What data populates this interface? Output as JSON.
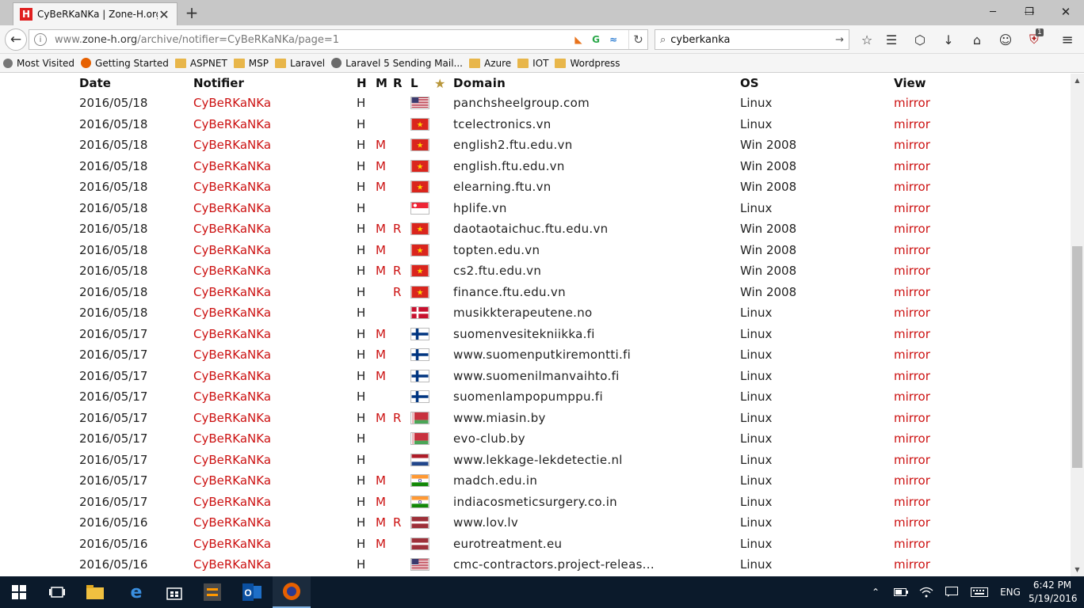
{
  "browser": {
    "tab_title": "CyBeRKaNKa | Zone-H.org",
    "tab_favicon": "H",
    "url_prefix": "www.",
    "url_host": "zone-h.org",
    "url_path": "/archive/notifier=CyBeRKaNKa/page=1",
    "search_query": "cyberkanka",
    "addon_badge": "1",
    "bookmarks": [
      "Most Visited",
      "Getting Started",
      "ASPNET",
      "MSP",
      "Laravel",
      "Laravel 5 Sending Mail...",
      "Azure",
      "IOT",
      "Wordpress"
    ]
  },
  "table": {
    "headers": {
      "date": "Date",
      "notifier": "Notifier",
      "h": "H",
      "m": "M",
      "r": "R",
      "l": "L",
      "domain": "Domain",
      "os": "OS",
      "view": "View"
    },
    "rows": [
      {
        "date": "2016/05/18",
        "notifier": "CyBeRKaNKa",
        "h": "H",
        "m": "",
        "r": "",
        "flag": "us",
        "domain": "panchsheelgroup.com",
        "os": "Linux",
        "view": "mirror"
      },
      {
        "date": "2016/05/18",
        "notifier": "CyBeRKaNKa",
        "h": "H",
        "m": "",
        "r": "",
        "flag": "vn",
        "domain": "tcelectronics.vn",
        "os": "Linux",
        "view": "mirror"
      },
      {
        "date": "2016/05/18",
        "notifier": "CyBeRKaNKa",
        "h": "H",
        "m": "M",
        "r": "",
        "flag": "vn",
        "domain": "english2.ftu.edu.vn",
        "os": "Win 2008",
        "view": "mirror"
      },
      {
        "date": "2016/05/18",
        "notifier": "CyBeRKaNKa",
        "h": "H",
        "m": "M",
        "r": "",
        "flag": "vn",
        "domain": "english.ftu.edu.vn",
        "os": "Win 2008",
        "view": "mirror"
      },
      {
        "date": "2016/05/18",
        "notifier": "CyBeRKaNKa",
        "h": "H",
        "m": "M",
        "r": "",
        "flag": "vn",
        "domain": "elearning.ftu.vn",
        "os": "Win 2008",
        "view": "mirror"
      },
      {
        "date": "2016/05/18",
        "notifier": "CyBeRKaNKa",
        "h": "H",
        "m": "",
        "r": "",
        "flag": "sg",
        "domain": "hplife.vn",
        "os": "Linux",
        "view": "mirror"
      },
      {
        "date": "2016/05/18",
        "notifier": "CyBeRKaNKa",
        "h": "H",
        "m": "M",
        "r": "R",
        "flag": "vn",
        "domain": "daotaotaichuc.ftu.edu.vn",
        "os": "Win 2008",
        "view": "mirror"
      },
      {
        "date": "2016/05/18",
        "notifier": "CyBeRKaNKa",
        "h": "H",
        "m": "M",
        "r": "",
        "flag": "vn",
        "domain": "topten.edu.vn",
        "os": "Win 2008",
        "view": "mirror"
      },
      {
        "date": "2016/05/18",
        "notifier": "CyBeRKaNKa",
        "h": "H",
        "m": "M",
        "r": "R",
        "flag": "vn",
        "domain": "cs2.ftu.edu.vn",
        "os": "Win 2008",
        "view": "mirror"
      },
      {
        "date": "2016/05/18",
        "notifier": "CyBeRKaNKa",
        "h": "H",
        "m": "",
        "r": "R",
        "flag": "vn",
        "domain": "finance.ftu.edu.vn",
        "os": "Win 2008",
        "view": "mirror"
      },
      {
        "date": "2016/05/18",
        "notifier": "CyBeRKaNKa",
        "h": "H",
        "m": "",
        "r": "",
        "flag": "dk",
        "domain": "musikkterapeutene.no",
        "os": "Linux",
        "view": "mirror"
      },
      {
        "date": "2016/05/17",
        "notifier": "CyBeRKaNKa",
        "h": "H",
        "m": "M",
        "r": "",
        "flag": "fi",
        "domain": "suomenvesitekniikka.fi",
        "os": "Linux",
        "view": "mirror"
      },
      {
        "date": "2016/05/17",
        "notifier": "CyBeRKaNKa",
        "h": "H",
        "m": "M",
        "r": "",
        "flag": "fi",
        "domain": "www.suomenputkiremontti.fi",
        "os": "Linux",
        "view": "mirror"
      },
      {
        "date": "2016/05/17",
        "notifier": "CyBeRKaNKa",
        "h": "H",
        "m": "M",
        "r": "",
        "flag": "fi",
        "domain": "www.suomenilmanvaihto.fi",
        "os": "Linux",
        "view": "mirror"
      },
      {
        "date": "2016/05/17",
        "notifier": "CyBeRKaNKa",
        "h": "H",
        "m": "",
        "r": "",
        "flag": "fi",
        "domain": "suomenlampopumppu.fi",
        "os": "Linux",
        "view": "mirror"
      },
      {
        "date": "2016/05/17",
        "notifier": "CyBeRKaNKa",
        "h": "H",
        "m": "M",
        "r": "R",
        "flag": "by",
        "domain": "www.miasin.by",
        "os": "Linux",
        "view": "mirror"
      },
      {
        "date": "2016/05/17",
        "notifier": "CyBeRKaNKa",
        "h": "H",
        "m": "",
        "r": "",
        "flag": "by",
        "domain": "evo-club.by",
        "os": "Linux",
        "view": "mirror"
      },
      {
        "date": "2016/05/17",
        "notifier": "CyBeRKaNKa",
        "h": "H",
        "m": "",
        "r": "",
        "flag": "nl",
        "domain": "www.lekkage-lekdetectie.nl",
        "os": "Linux",
        "view": "mirror"
      },
      {
        "date": "2016/05/17",
        "notifier": "CyBeRKaNKa",
        "h": "H",
        "m": "M",
        "r": "",
        "flag": "in",
        "domain": "madch.edu.in",
        "os": "Linux",
        "view": "mirror"
      },
      {
        "date": "2016/05/17",
        "notifier": "CyBeRKaNKa",
        "h": "H",
        "m": "M",
        "r": "",
        "flag": "in",
        "domain": "indiacosmeticsurgery.co.in",
        "os": "Linux",
        "view": "mirror"
      },
      {
        "date": "2016/05/16",
        "notifier": "CyBeRKaNKa",
        "h": "H",
        "m": "M",
        "r": "R",
        "flag": "lv",
        "domain": "www.lov.lv",
        "os": "Linux",
        "view": "mirror"
      },
      {
        "date": "2016/05/16",
        "notifier": "CyBeRKaNKa",
        "h": "H",
        "m": "M",
        "r": "",
        "flag": "lv",
        "domain": "eurotreatment.eu",
        "os": "Linux",
        "view": "mirror"
      },
      {
        "date": "2016/05/16",
        "notifier": "CyBeRKaNKa",
        "h": "H",
        "m": "",
        "r": "",
        "flag": "us",
        "domain": "cmc-contractors.project-releas...",
        "os": "Linux",
        "view": "mirror"
      }
    ]
  },
  "taskbar": {
    "language": "ENG",
    "time": "6:42 PM",
    "date": "5/19/2016"
  },
  "colors": {
    "notifier_red": "#cc1111",
    "taskbar_bg": "#0b1a2b",
    "tabstrip_bg": "#c7c7c7"
  }
}
